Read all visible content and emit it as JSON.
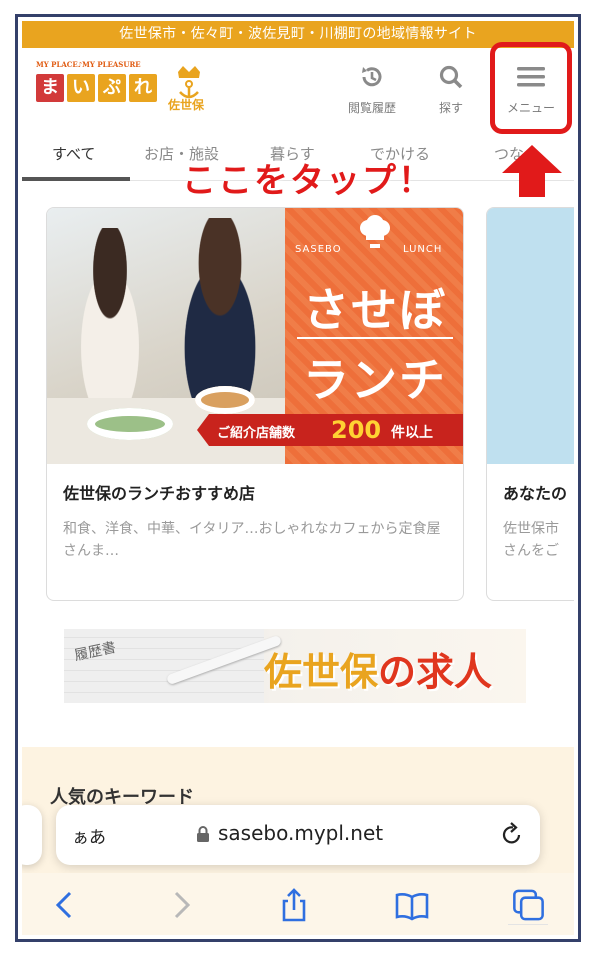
{
  "site": {
    "topbar_text": "佐世保市・佐々町・波佐見町・川棚町の地域情報サイト",
    "logo_tagline": "MY PLACE♪MY PLEASURE",
    "logo_chars": [
      "ま",
      "い",
      "ぷ",
      "れ"
    ],
    "logo_city": "佐世保"
  },
  "header": {
    "history_label": "閲覧履歴",
    "search_label": "探す",
    "menu_label": "メニュー"
  },
  "tabs": [
    {
      "label": "すべて",
      "active": true
    },
    {
      "label": "お店・施設",
      "active": false
    },
    {
      "label": "暮らす",
      "active": false
    },
    {
      "label": "でかける",
      "active": false
    },
    {
      "label": "つな",
      "active": false
    }
  ],
  "annotation": {
    "callout": "ここをタップ！",
    "highlight_color": "#e11a1a"
  },
  "cards": [
    {
      "title": "佐世保のランチおすすめ店",
      "description": "和食、洋食、中華、イタリア…おしゃれなカフェから定食屋さんま…",
      "banner": {
        "tag_left": "SASEBO",
        "tag_right": "LUNCH",
        "headline_1": "させぼ",
        "headline_2": "ランチ",
        "ribbon_prefix": "ご紹介店舗数",
        "ribbon_count": "200",
        "ribbon_suffix": "件以上"
      }
    },
    {
      "title": "あなたの",
      "description_line1": "佐世保市",
      "description_line2": "さんをご"
    }
  ],
  "jobs_banner": {
    "doc_text": "履歴書",
    "text_1": "佐世保",
    "text_2": "の",
    "text_3": "求人"
  },
  "keywords": {
    "title": "人気のキーワード"
  },
  "browser": {
    "text_size_label": "ぁあ",
    "url": "sasebo.mypl.net"
  },
  "colors": {
    "brand_orange": "#e9a41f",
    "accent_red": "#e11a1a",
    "promo_orange": "#ee6f3a"
  }
}
